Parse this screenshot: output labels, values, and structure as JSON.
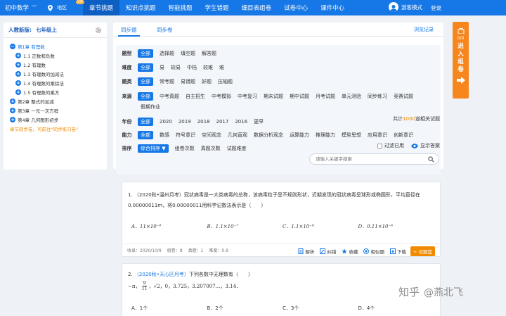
{
  "topnav": {
    "subject": "初中数学",
    "region": "地区",
    "vip": "VIP",
    "items": [
      "章节挑题",
      "知识点挑题",
      "智能挑题",
      "学生错题",
      "细目表组卷",
      "试卷中心",
      "课件中心"
    ],
    "user": "游客模式",
    "login": "登录",
    "accent": "#1677e6"
  },
  "sidebar": {
    "textbook": "人教新版:",
    "grade": "七年级上",
    "tree": [
      {
        "label": "第1章 有理数",
        "level": 1,
        "expanded": true
      },
      {
        "label": "1.1 正数和负数",
        "level": 2
      },
      {
        "label": "1.2 有理数",
        "level": 2
      },
      {
        "label": "1.3 有理数的加减法",
        "level": 2
      },
      {
        "label": "1.4 有理数的乘除法",
        "level": 2
      },
      {
        "label": "1.5 有理数的乘方",
        "level": 2
      },
      {
        "label": "第2章 整式的加减",
        "level": 1
      },
      {
        "label": "第3章 一元一次方程",
        "level": 1
      },
      {
        "label": "第4章 几何图形初步",
        "level": 1
      }
    ],
    "tip": "章节同步卷，可前往\"同步练习卷\""
  },
  "filter": {
    "tabs": [
      "同步题",
      "同步卷"
    ],
    "browse": "浏览记录",
    "rows": [
      {
        "label": "题型",
        "options": [
          "全部",
          "选择题",
          "填空题",
          "解答题"
        ]
      },
      {
        "label": "难度",
        "options": [
          "全部",
          "易",
          "较易",
          "中档",
          "较难",
          "难"
        ]
      },
      {
        "label": "题类",
        "options": [
          "全部",
          "常考题",
          "易错题",
          "好题",
          "压轴题"
        ]
      },
      {
        "label": "来源",
        "options": [
          "全部",
          "中考真题",
          "自主招生",
          "中考模拟",
          "中考复习",
          "期末试题",
          "期中试题",
          "月考试题",
          "单元测验",
          "同步练习",
          "竞赛试题"
        ],
        "options2": [
          "假期作业"
        ]
      },
      {
        "label": "年份",
        "options": [
          "全部",
          "2020",
          "2019",
          "2018",
          "2017",
          "2016",
          "更早"
        ]
      },
      {
        "label": "能力",
        "options": [
          "全部",
          "数感",
          "符号意识",
          "空间观念",
          "几何直观",
          "数据分析观念",
          "运算能力",
          "推理能力",
          "模型思想",
          "应用意识",
          "创新意识"
        ]
      },
      {
        "label": "排序",
        "options": [
          "综合排序 ▼",
          "组卷次数",
          "真题次数",
          "试题难度"
        ]
      }
    ],
    "total_prefix": "共计",
    "total_num": "1000",
    "total_suffix": "道相关试题",
    "filter_used": "过滤已用",
    "show_answer": "显示答案",
    "search_placeholder": "请输入关键字搜索"
  },
  "questions": [
    {
      "num": "1.",
      "source": "（2020秋•温州月考）",
      "text": "冠状病毒是一大类病毒的总称，该病毒粒子呈不规则形状，近期发现的冠状病毒呈球形或椭圆形，平均直径在0.00000011m，将0.00000011用科学记数法表示是（　　）",
      "options": [
        "A．11×10⁻⁸",
        "B．1.1×10⁻⁷",
        "C．1.1×10⁻⁸",
        "D．0.11×10⁻⁶"
      ],
      "meta": [
        "收录：2020/10/9",
        "组卷：8",
        "真题：1",
        "难度：0.9"
      ],
      "actions": [
        "解析",
        "纠错",
        "收藏",
        "相似题",
        "下载"
      ],
      "add": "+ 试题篮"
    },
    {
      "num": "2.",
      "source": "（2020秋•天心区月考）",
      "text": "下列各数中无理数有（　　）",
      "line2_a": "−π，",
      "frac_n": "9",
      "frac_d": "11",
      "line2_b": "，√2，0，3.725，3.207007…，3.14．",
      "options": [
        "A．1个",
        "B．2个",
        "C．3个",
        "D．4个"
      ]
    }
  ],
  "float": {
    "count": "0/0",
    "label": [
      "进",
      "入",
      "组",
      "卷"
    ]
  },
  "watermark": {
    "zh": "知乎",
    "handle": "@燕北飞"
  }
}
